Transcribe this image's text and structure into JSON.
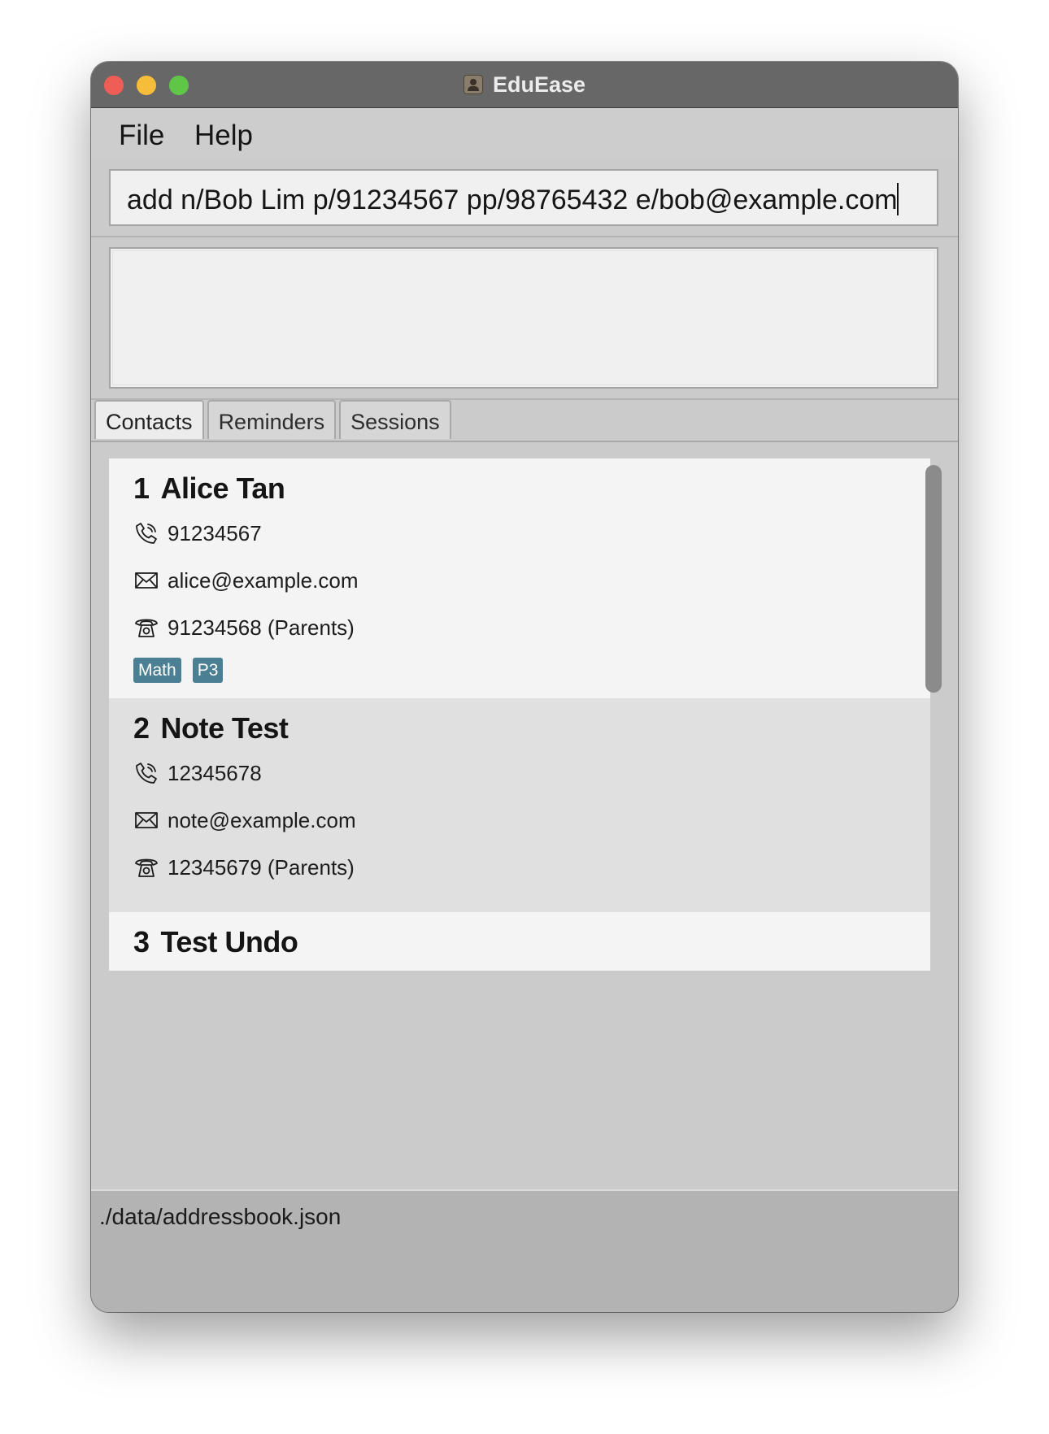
{
  "window": {
    "title": "EduEase"
  },
  "menu": {
    "file": "File",
    "help": "Help"
  },
  "command": {
    "value": "add n/Bob Lim p/91234567 pp/98765432 e/bob@example.com"
  },
  "result": {
    "text": ""
  },
  "tabs": [
    {
      "label": "Contacts",
      "active": true
    },
    {
      "label": "Reminders",
      "active": false
    },
    {
      "label": "Sessions",
      "active": false
    }
  ],
  "contacts": [
    {
      "index": "1",
      "name": "Alice Tan",
      "phone": "91234567",
      "email": "alice@example.com",
      "parent_phone": "91234568 (Parents)",
      "tags": [
        "Math",
        "P3"
      ]
    },
    {
      "index": "2",
      "name": "Note Test",
      "phone": "12345678",
      "email": "note@example.com",
      "parent_phone": "12345679 (Parents)",
      "tags": []
    },
    {
      "index": "3",
      "name": "Test Undo"
    }
  ],
  "status": {
    "path": "./data/addressbook.json"
  },
  "icons": {
    "phone": "phone-icon",
    "email": "envelope-icon",
    "parent_phone": "telephone-icon",
    "app": "contacts-app-icon"
  },
  "colors": {
    "titlebar": "#676767",
    "tag": "#4a7f94",
    "card_light": "#f4f4f4",
    "card_dark": "#e0e0e0"
  }
}
